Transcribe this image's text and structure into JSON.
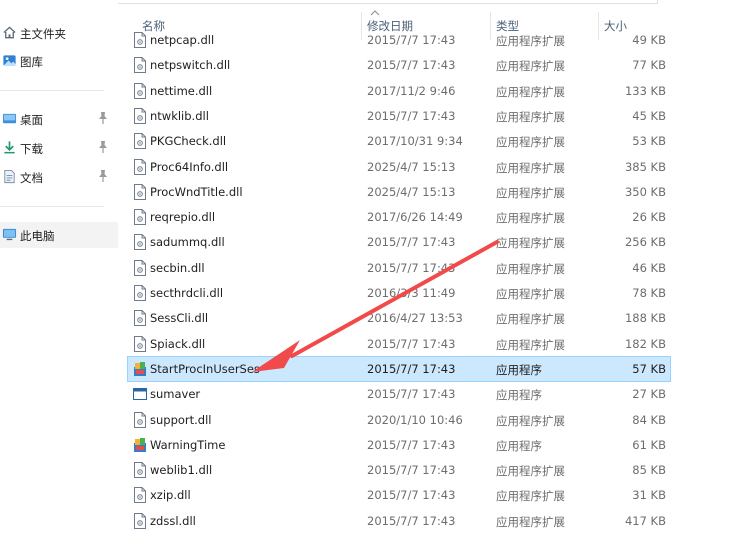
{
  "nav": {
    "quick_access": [
      {
        "label": "主文件夹",
        "icon": "home-icon"
      },
      {
        "label": "图库",
        "icon": "gallery-icon"
      }
    ],
    "pinned": [
      {
        "label": "桌面",
        "icon": "desktop-folder-icon"
      },
      {
        "label": "下载",
        "icon": "download-icon"
      },
      {
        "label": "文档",
        "icon": "documents-icon"
      }
    ],
    "this_pc": {
      "label": "此电脑",
      "icon": "this-pc-icon"
    }
  },
  "columns": {
    "name": "名称",
    "date": "修改日期",
    "type": "类型",
    "size": "大小"
  },
  "files": [
    {
      "name": "netpcap.dll",
      "date": "2015/7/7 17:43",
      "type": "应用程序扩展",
      "size": "49 KB",
      "kind": "dll"
    },
    {
      "name": "netpswitch.dll",
      "date": "2015/7/7 17:43",
      "type": "应用程序扩展",
      "size": "77 KB",
      "kind": "dll"
    },
    {
      "name": "nettime.dll",
      "date": "2017/11/2 9:46",
      "type": "应用程序扩展",
      "size": "133 KB",
      "kind": "dll"
    },
    {
      "name": "ntwklib.dll",
      "date": "2015/7/7 17:43",
      "type": "应用程序扩展",
      "size": "45 KB",
      "kind": "dll"
    },
    {
      "name": "PKGCheck.dll",
      "date": "2017/10/31 9:34",
      "type": "应用程序扩展",
      "size": "53 KB",
      "kind": "dll"
    },
    {
      "name": "Proc64Info.dll",
      "date": "2025/4/7 15:13",
      "type": "应用程序扩展",
      "size": "385 KB",
      "kind": "dll"
    },
    {
      "name": "ProcWndTitle.dll",
      "date": "2025/4/7 15:13",
      "type": "应用程序扩展",
      "size": "350 KB",
      "kind": "dll"
    },
    {
      "name": "reqrepio.dll",
      "date": "2017/6/26 14:49",
      "type": "应用程序扩展",
      "size": "26 KB",
      "kind": "dll"
    },
    {
      "name": "sadummq.dll",
      "date": "2015/7/7 17:43",
      "type": "应用程序扩展",
      "size": "256 KB",
      "kind": "dll"
    },
    {
      "name": "secbin.dll",
      "date": "2015/7/7 17:43",
      "type": "应用程序扩展",
      "size": "46 KB",
      "kind": "dll"
    },
    {
      "name": "secthrdcli.dll",
      "date": "2016/3/3 11:49",
      "type": "应用程序扩展",
      "size": "78 KB",
      "kind": "dll"
    },
    {
      "name": "SessCli.dll",
      "date": "2016/4/27 13:53",
      "type": "应用程序扩展",
      "size": "188 KB",
      "kind": "dll"
    },
    {
      "name": "Spiack.dll",
      "date": "2015/7/7 17:43",
      "type": "应用程序扩展",
      "size": "182 KB",
      "kind": "dll"
    },
    {
      "name": "StartProcInUserSes",
      "date": "2015/7/7 17:43",
      "type": "应用程序",
      "size": "57 KB",
      "kind": "exe-color",
      "selected": true
    },
    {
      "name": "sumaver",
      "date": "2015/7/7 17:43",
      "type": "应用程序",
      "size": "27 KB",
      "kind": "exe-window"
    },
    {
      "name": "support.dll",
      "date": "2020/1/10 10:46",
      "type": "应用程序扩展",
      "size": "84 KB",
      "kind": "dll"
    },
    {
      "name": "WarningTime",
      "date": "2015/7/7 17:43",
      "type": "应用程序",
      "size": "61 KB",
      "kind": "exe-color"
    },
    {
      "name": "weblib1.dll",
      "date": "2015/7/7 17:43",
      "type": "应用程序扩展",
      "size": "85 KB",
      "kind": "dll"
    },
    {
      "name": "xzip.dll",
      "date": "2015/7/7 17:43",
      "type": "应用程序扩展",
      "size": "31 KB",
      "kind": "dll"
    },
    {
      "name": "zdssl.dll",
      "date": "2015/7/7 17:43",
      "type": "应用程序扩展",
      "size": "417 KB",
      "kind": "dll"
    }
  ],
  "colors": {
    "selection_fill": "#cce8ff",
    "selection_border": "#99d1ff",
    "annotation_arrow": "#f04a4a",
    "header_text": "#4c607a"
  }
}
